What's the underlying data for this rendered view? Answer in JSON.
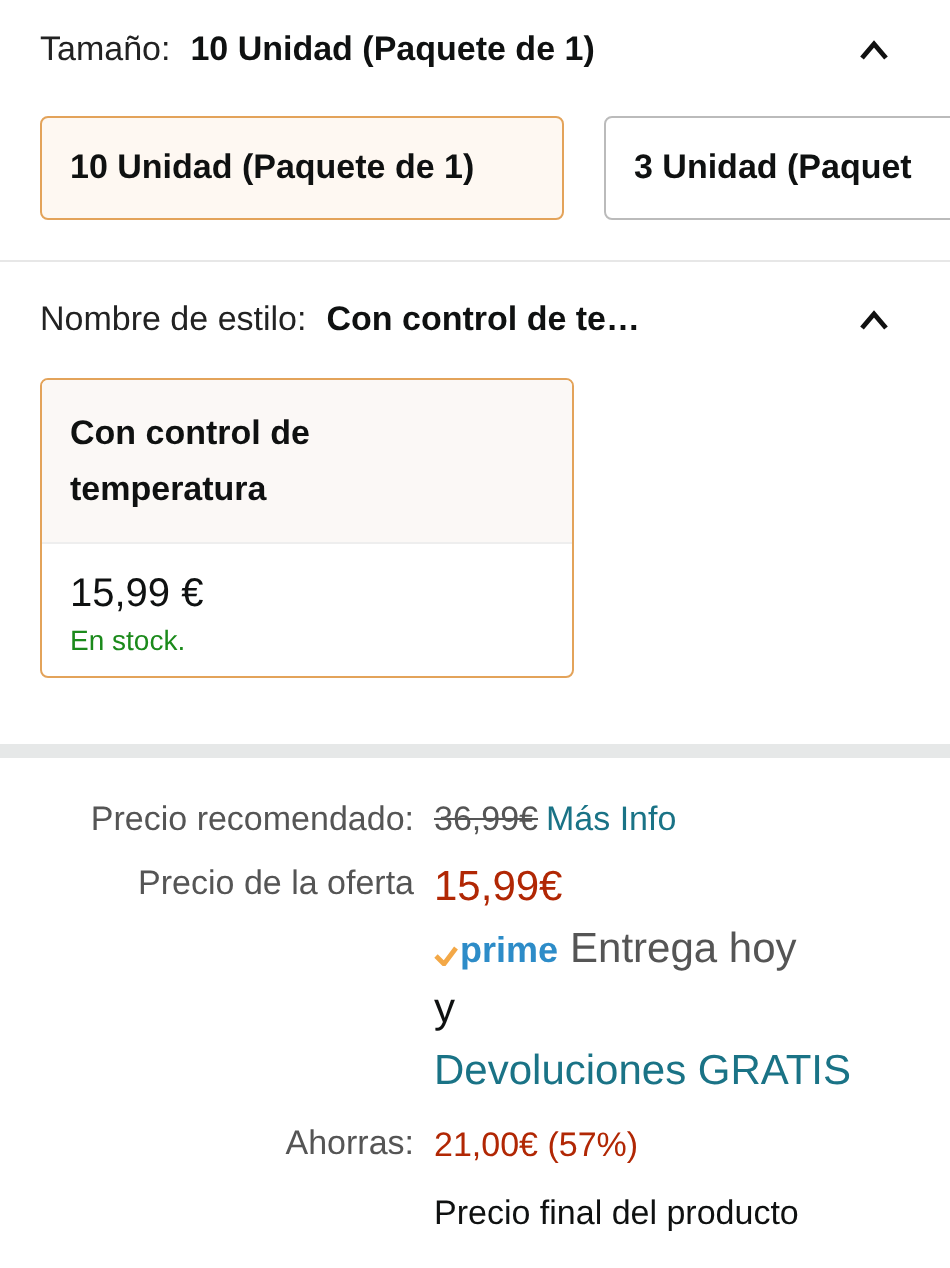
{
  "sections": [
    {
      "label": "Tamaño:",
      "value": "10 Unidad (Paquete de 1)",
      "expanded": true,
      "options": [
        {
          "kind": "chip",
          "title": "10 Unidad (Paquete de 1)",
          "selected": true
        },
        {
          "kind": "chip",
          "title": "3 Unidad (Paquet",
          "selected": false
        }
      ]
    },
    {
      "label": "Nombre de estilo:",
      "value": "Con control de te…",
      "expanded": true,
      "options": [
        {
          "kind": "card",
          "title": "Con control de temperatura",
          "price": "15,99 €",
          "stock": "En stock.",
          "selected": true
        }
      ]
    }
  ],
  "pricing": {
    "list_price": {
      "label": "Precio recomendado:",
      "value": "36,99€",
      "link": "Más Info"
    },
    "deal_price": {
      "label": "Precio de la oferta",
      "value": "15,99€",
      "prime": "prime",
      "delivery": "Entrega hoy",
      "conjunction": "y",
      "returns": "Devoluciones GRATIS"
    },
    "savings": {
      "label": "Ahorras:",
      "value": "21,00€ (57%)",
      "note": "Precio final del producto"
    }
  }
}
